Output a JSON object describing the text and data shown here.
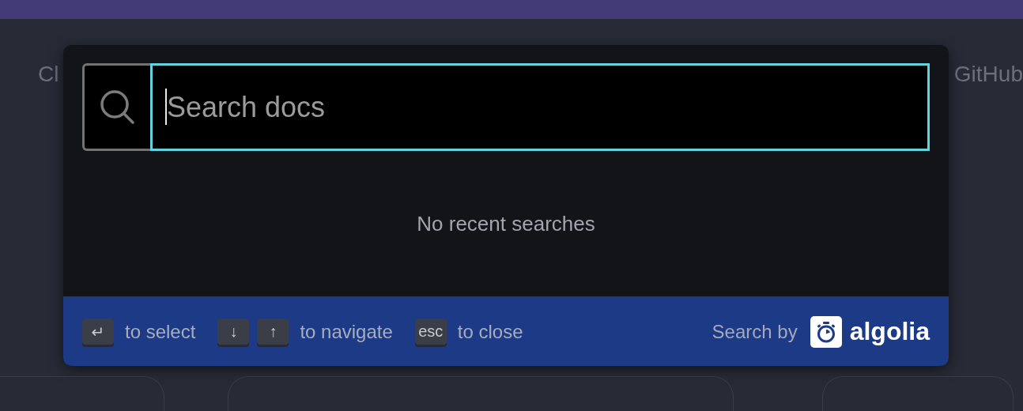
{
  "background": {
    "nav_left": "Cl",
    "nav_right": "GitHub"
  },
  "search_modal": {
    "search": {
      "placeholder": "Search docs"
    },
    "empty_message": "No recent searches",
    "footer": {
      "hints": [
        {
          "keys": [
            "↵"
          ],
          "label": "to select"
        },
        {
          "keys": [
            "↓",
            "↑"
          ],
          "label": "to navigate"
        },
        {
          "keys": [
            "esc"
          ],
          "label": "to close"
        }
      ],
      "search_by": "Search by",
      "logo_text": "algolia"
    }
  }
}
